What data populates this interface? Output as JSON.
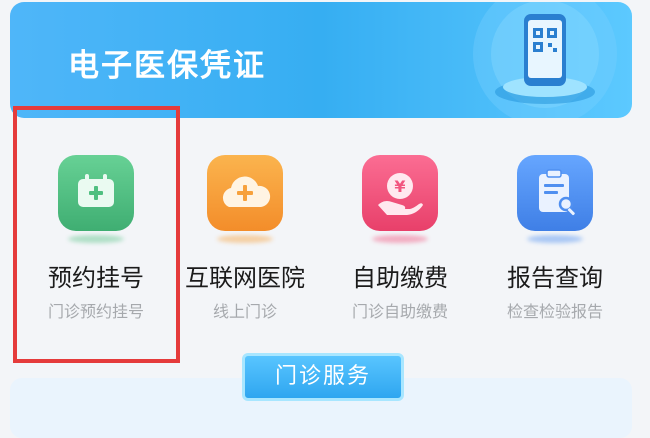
{
  "banner": {
    "title": "电子医保凭证",
    "icon": "phone-qr-code-icon"
  },
  "services": [
    {
      "title": "预约挂号",
      "subtitle": "门诊预约挂号",
      "icon": "calendar-plus-icon",
      "color": "#5cc489"
    },
    {
      "title": "互联网医院",
      "subtitle": "线上门诊",
      "icon": "cloud-plus-icon",
      "color": "#f7a13c"
    },
    {
      "title": "自助缴费",
      "subtitle": "门诊自助缴费",
      "icon": "yen-coin-hand-icon",
      "color": "#f2557f"
    },
    {
      "title": "报告查询",
      "subtitle": "检查检验报告",
      "icon": "clipboard-search-icon",
      "color": "#4f8ff0"
    }
  ],
  "section": {
    "tab_label": "门诊服务"
  },
  "colors": {
    "banner": "#40b2f5",
    "highlight_border": "#e53b3b"
  }
}
